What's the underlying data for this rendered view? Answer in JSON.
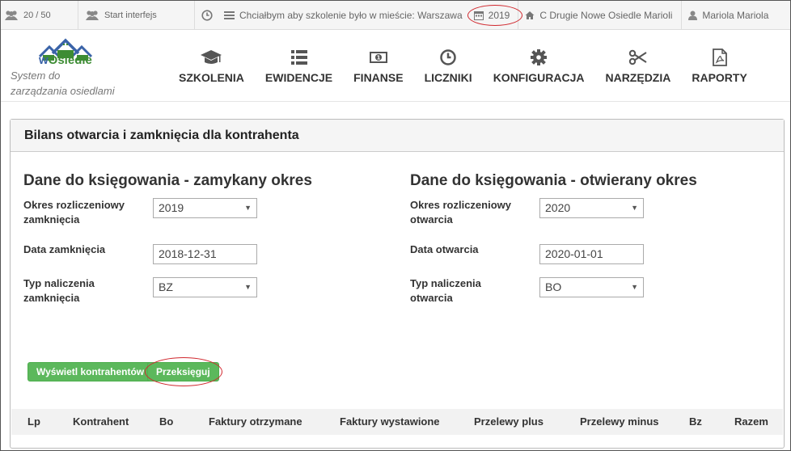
{
  "topbar": {
    "users_count": "20 / 50",
    "start_label": "Start interfejs",
    "message": "Chciałbym aby szkolenie było w mieście: Warszawa",
    "year": "2019",
    "address": "C Drugie Nowe Osiedle Marioli",
    "user": "Mariola Mariola"
  },
  "header": {
    "logo_prefix": "w",
    "logo_name": "Osiedle",
    "tagline_line1": "System do",
    "tagline_line2": "zarządzania osiedlami",
    "nav": [
      {
        "label": "SZKOLENIA",
        "icon": "graduation-cap-icon"
      },
      {
        "label": "EWIDENCJE",
        "icon": "list-icon"
      },
      {
        "label": "FINANSE",
        "icon": "money-icon"
      },
      {
        "label": "LICZNIKI",
        "icon": "clock-icon"
      },
      {
        "label": "KONFIGURACJA",
        "icon": "gear-icon"
      },
      {
        "label": "NARZĘDZIA",
        "icon": "scissors-icon"
      },
      {
        "label": "RAPORTY",
        "icon": "pdf-icon"
      }
    ]
  },
  "panel": {
    "title": "Bilans otwarcia i zamknięcia dla kontrahenta",
    "left": {
      "title": "Dane do księgowania - zamykany okres",
      "period_label_1": "Okres rozliczeniowy",
      "period_label_2": "zamknięcia",
      "period_value": "2019",
      "date_label": "Data zamknięcia",
      "date_value": "2018-12-31",
      "type_label_1": "Typ naliczenia",
      "type_label_2": "zamknięcia",
      "type_value": "BZ"
    },
    "right": {
      "title": "Dane do księgowania - otwierany okres",
      "period_label_1": "Okres rozliczeniowy",
      "period_label_2": "otwarcia",
      "period_value": "2020",
      "date_label": "Data otwarcia",
      "date_value": "2020-01-01",
      "type_label_1": "Typ naliczenia",
      "type_label_2": "otwarcia",
      "type_value": "BO"
    },
    "buttons": {
      "show": "Wyświetl kontrahentów",
      "repost": "Przeksięguj"
    },
    "table_headers": [
      "Lp",
      "Kontrahent",
      "Bo",
      "Faktury otrzymane",
      "Faktury wystawione",
      "Przelewy plus",
      "Przelewy minus",
      "Bz",
      "Razem"
    ]
  },
  "colors": {
    "accent_green": "#5cb85c",
    "highlight_red": "#d0282e",
    "logo_blue": "#3a63a8",
    "logo_green": "#3d8c34"
  }
}
